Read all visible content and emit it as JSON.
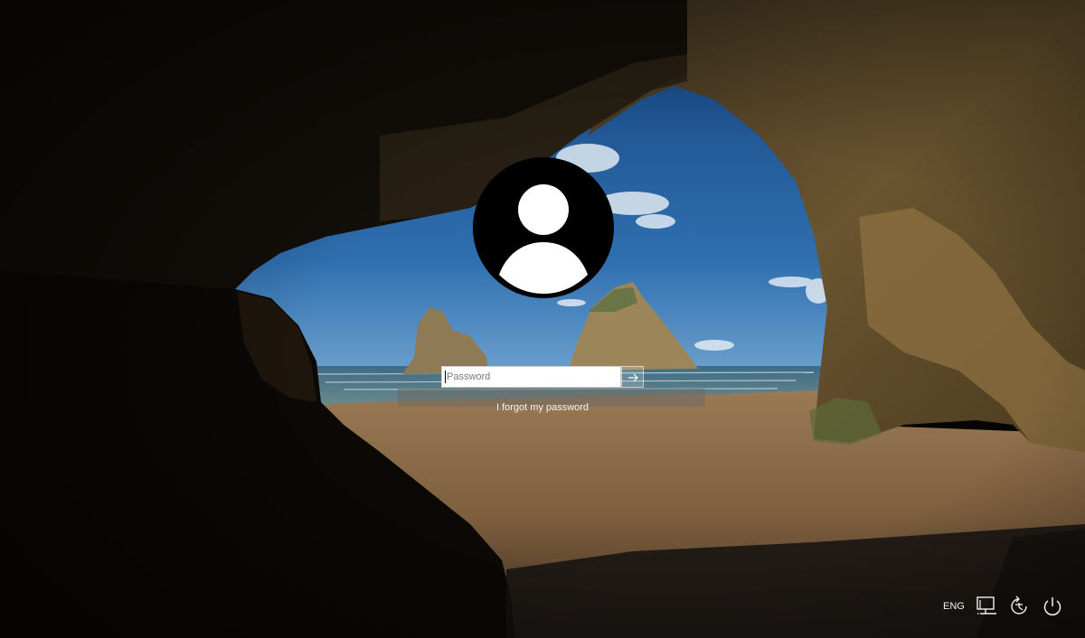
{
  "login": {
    "password_placeholder": "Password",
    "password_value": "",
    "forgot_password_label": "I forgot my password"
  },
  "tray": {
    "language_label": "ENG",
    "icons": [
      "network-icon",
      "ease-of-access-icon",
      "power-icon"
    ]
  },
  "colors": {
    "sky": "#2f6fb0",
    "sand": "#8a6a45",
    "rock": "#6b5530",
    "cave_dark": "#050403",
    "text_white": "#f2f2f2"
  }
}
